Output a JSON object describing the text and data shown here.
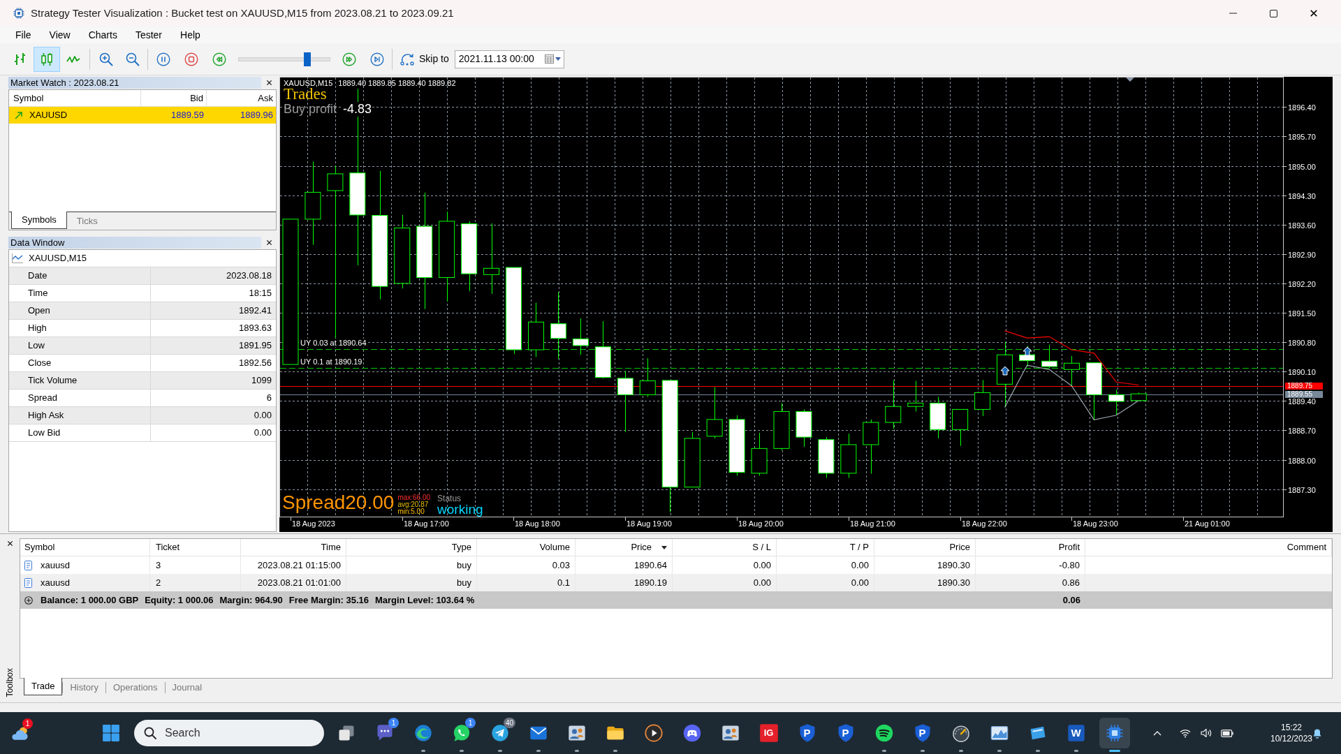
{
  "window": {
    "title": "Strategy Tester Visualization : Bucket test on XAUUSD,M15 from 2023.08.21 to 2023.09.21"
  },
  "menu": [
    "File",
    "View",
    "Charts",
    "Tester",
    "Help"
  ],
  "toolbar": {
    "chart_modes": [
      {
        "kind": "bars",
        "selected": false
      },
      {
        "kind": "candles",
        "selected": true
      },
      {
        "kind": "line",
        "selected": false
      }
    ],
    "zoom": [
      {
        "kind": "zoom-in"
      },
      {
        "kind": "zoom-out"
      }
    ],
    "playback": [
      {
        "kind": "pause"
      },
      {
        "kind": "stop"
      },
      {
        "kind": "rewind"
      }
    ],
    "speed": {
      "level": 0.75
    },
    "stepping": [
      {
        "kind": "fast-forward"
      },
      {
        "kind": "step-end"
      }
    ],
    "skip": {
      "label": "Skip to",
      "value": "2021.11.13 00:00"
    }
  },
  "market_watch": {
    "title": "Market Watch : 2023.08.21",
    "columns": [
      "Symbol",
      "Bid",
      "Ask"
    ],
    "rows": [
      {
        "symbol": "XAUUSD",
        "bid": "1889.59",
        "ask": "1889.96",
        "rising": true,
        "selected": true
      }
    ],
    "tabs": [
      {
        "label": "Symbols",
        "selected": true
      },
      {
        "label": "Ticks",
        "selected": false
      }
    ]
  },
  "data_window": {
    "title": "Data Window",
    "symbol": "XAUUSD,M15",
    "rows": [
      {
        "label": "Date",
        "value": "2023.08.18"
      },
      {
        "label": "Time",
        "value": "18:15"
      },
      {
        "label": "Open",
        "value": "1892.41"
      },
      {
        "label": "High",
        "value": "1893.63"
      },
      {
        "label": "Low",
        "value": "1891.95"
      },
      {
        "label": "Close",
        "value": "1892.56"
      },
      {
        "label": "Tick Volume",
        "value": "1099"
      },
      {
        "label": "Spread",
        "value": "6"
      },
      {
        "label": "High Ask",
        "value": "0.00"
      },
      {
        "label": "Low Bid",
        "value": "0.00"
      }
    ]
  },
  "chart": {
    "symbol": "XAUUSD,M15",
    "info": "1889.40 1889.85 1889.40 1889.82",
    "title": "Trades",
    "profit_label": "Buy profit",
    "profit_value": "-4.83",
    "trade_labels": [
      "UY 0.03 at 1890.64",
      "UY 0.1 at 1890.19"
    ],
    "spread": {
      "label": "Spread",
      "value": "20.00",
      "max": "max:66.00",
      "avg": "avg:20.87",
      "min": "min:5.00"
    },
    "status": {
      "label": "Status",
      "value": "working"
    },
    "chart_data": {
      "type": "line",
      "grid": true,
      "categories": [
        null,
        "18 Aug 2023",
        null,
        null,
        null,
        null,
        "18 Aug 17:00",
        null,
        null,
        null,
        null,
        "18 Aug 18:00",
        null,
        null,
        null,
        null,
        "18 Aug 19:00",
        null,
        null,
        null,
        null,
        "18 Aug 20:00",
        null,
        null,
        null,
        null,
        "18 Aug 21:00",
        null,
        null,
        null,
        null,
        "18 Aug 22:00",
        null,
        null,
        null,
        null,
        "18 Aug 23:00",
        null,
        null,
        null,
        null,
        "21 Aug 01:00",
        null,
        null,
        null
      ],
      "ylim": [
        1886.63,
        1897.12
      ],
      "yticks": [
        {
          "value": 1887.3,
          "label": "1887.30"
        },
        {
          "value": 1888.0,
          "label": "1888.00"
        },
        {
          "value": 1888.7,
          "label": "1888.70"
        },
        {
          "value": 1889.4,
          "label": "1889.40"
        },
        {
          "value": 1890.1,
          "label": "1890.10"
        },
        {
          "value": 1890.8,
          "label": "1890.80"
        },
        {
          "value": 1891.5,
          "label": "1891.50"
        },
        {
          "value": 1892.2,
          "label": "1892.20"
        },
        {
          "value": 1892.9,
          "label": "1892.90"
        },
        {
          "value": 1893.6,
          "label": "1893.60"
        },
        {
          "value": 1894.3,
          "label": "1894.30"
        },
        {
          "value": 1895.0,
          "label": "1895.00"
        },
        {
          "value": 1895.7,
          "label": "1895.70"
        },
        {
          "value": 1896.4,
          "label": "1896.40"
        }
      ],
      "series": [
        {
          "color": "#ff0000",
          "values": [
            null,
            null,
            null,
            null,
            null,
            null,
            null,
            null,
            null,
            null,
            null,
            null,
            null,
            null,
            null,
            null,
            null,
            null,
            null,
            null,
            null,
            null,
            null,
            null,
            null,
            null,
            null,
            null,
            null,
            null,
            null,
            null,
            1891.07,
            1890.9,
            1890.93,
            1890.62,
            1890.54,
            1889.85,
            1889.78,
            null,
            null,
            null,
            null,
            null,
            null
          ]
        },
        {
          "color": "#9aa4ae",
          "values": [
            null,
            null,
            null,
            null,
            null,
            null,
            null,
            null,
            null,
            null,
            null,
            null,
            null,
            null,
            null,
            null,
            null,
            null,
            null,
            null,
            null,
            null,
            null,
            null,
            null,
            null,
            null,
            null,
            null,
            null,
            null,
            null,
            1889.25,
            1890.25,
            1890.15,
            1889.76,
            1888.95,
            1889.06,
            1889.41,
            null,
            null,
            null,
            null,
            null,
            null
          ]
        }
      ],
      "ref_lines": [
        {
          "axis": "y",
          "value": 1890.64,
          "color": "#00c800"
        },
        {
          "axis": "y",
          "value": 1890.19,
          "color": "#00c800"
        },
        {
          "axis": "y",
          "value": 1889.75,
          "label": "1889.75",
          "color": "#ff0000"
        },
        {
          "axis": "y",
          "value": 1889.55,
          "label": "1889.55",
          "color": "#778899"
        }
      ]
    }
  },
  "toolbox": {
    "title": "Toolbox",
    "columns": [
      {
        "label": "Symbol",
        "sorted": false
      },
      {
        "label": "Ticket",
        "sorted": false
      },
      {
        "label": "Time",
        "sorted": false
      },
      {
        "label": "Type",
        "sorted": false
      },
      {
        "label": "Volume",
        "sorted": false
      },
      {
        "label": "Price",
        "sorted": true
      },
      {
        "label": "S / L",
        "sorted": false
      },
      {
        "label": "T / P",
        "sorted": false
      },
      {
        "label": "Price",
        "sorted": false
      },
      {
        "label": "Profit",
        "sorted": false
      },
      {
        "label": "Comment",
        "sorted": false
      }
    ],
    "rows": [
      {
        "cells": [
          "xauusd",
          "3",
          "2023.08.21 01:15:00",
          "buy",
          "0.03",
          "1890.64",
          "0.00",
          "0.00",
          "1890.30",
          "-0.80"
        ]
      },
      {
        "cells": [
          "xauusd",
          "2",
          "2023.08.21 01:01:00",
          "buy",
          "0.1",
          "1890.19",
          "0.00",
          "0.00",
          "1890.30",
          "0.86"
        ]
      }
    ],
    "summary": {
      "items": [
        "Balance: 1 000.00 GBP",
        "Equity: 1 000.06",
        "Margin: 964.90",
        "Free Margin: 35.16",
        "Margin Level: 103.64 %"
      ],
      "profit": "0.06"
    },
    "tabs": [
      {
        "label": "Trade",
        "selected": true
      },
      {
        "label": "History",
        "selected": false
      },
      {
        "label": "Operations",
        "selected": false
      },
      {
        "label": "Journal",
        "selected": false
      }
    ]
  },
  "taskbar": {
    "weather": {
      "badge": {
        "text": "1",
        "color": "#e81123"
      }
    },
    "search": {
      "placeholder": "Search"
    },
    "apps": [
      {
        "kind": "task-view",
        "running": false,
        "selected": false
      },
      {
        "kind": "chat",
        "badge": {
          "text": "1",
          "color": "#3b82f6"
        },
        "running": false,
        "selected": false
      },
      {
        "kind": "globe",
        "running": true,
        "selected": false
      },
      {
        "kind": "phone-chat",
        "badge": {
          "text": "1",
          "color": "#3b82f6"
        },
        "running": true,
        "selected": false
      },
      {
        "kind": "plane",
        "badge": {
          "text": "40",
          "color": "#6b7280"
        },
        "running": true,
        "selected": false
      },
      {
        "kind": "mail",
        "running": true,
        "selected": false
      },
      {
        "kind": "people",
        "running": true,
        "selected": false
      },
      {
        "kind": "folder",
        "running": true,
        "selected": false
      },
      {
        "kind": "play",
        "running": false,
        "selected": false
      },
      {
        "kind": "controller",
        "running": false,
        "selected": false
      },
      {
        "kind": "people",
        "running": false,
        "selected": false
      },
      {
        "kind": "tile",
        "label": "IG",
        "running": false,
        "selected": false
      },
      {
        "kind": "shield",
        "label": "P",
        "running": false,
        "selected": false
      },
      {
        "kind": "shield",
        "label": "P",
        "running": false,
        "selected": false
      },
      {
        "kind": "music",
        "running": true,
        "selected": false
      },
      {
        "kind": "shield",
        "label": "P",
        "running": true,
        "selected": false
      },
      {
        "kind": "gauge",
        "running": true,
        "selected": false
      },
      {
        "kind": "picture",
        "running": true,
        "selected": false
      },
      {
        "kind": "window",
        "running": true,
        "selected": false
      },
      {
        "kind": "doc",
        "label": "W",
        "running": true,
        "selected": false
      },
      {
        "kind": "chip",
        "running": true,
        "selected": true
      }
    ],
    "tray": {
      "time": "15:22",
      "date": "10/12/2023"
    }
  }
}
